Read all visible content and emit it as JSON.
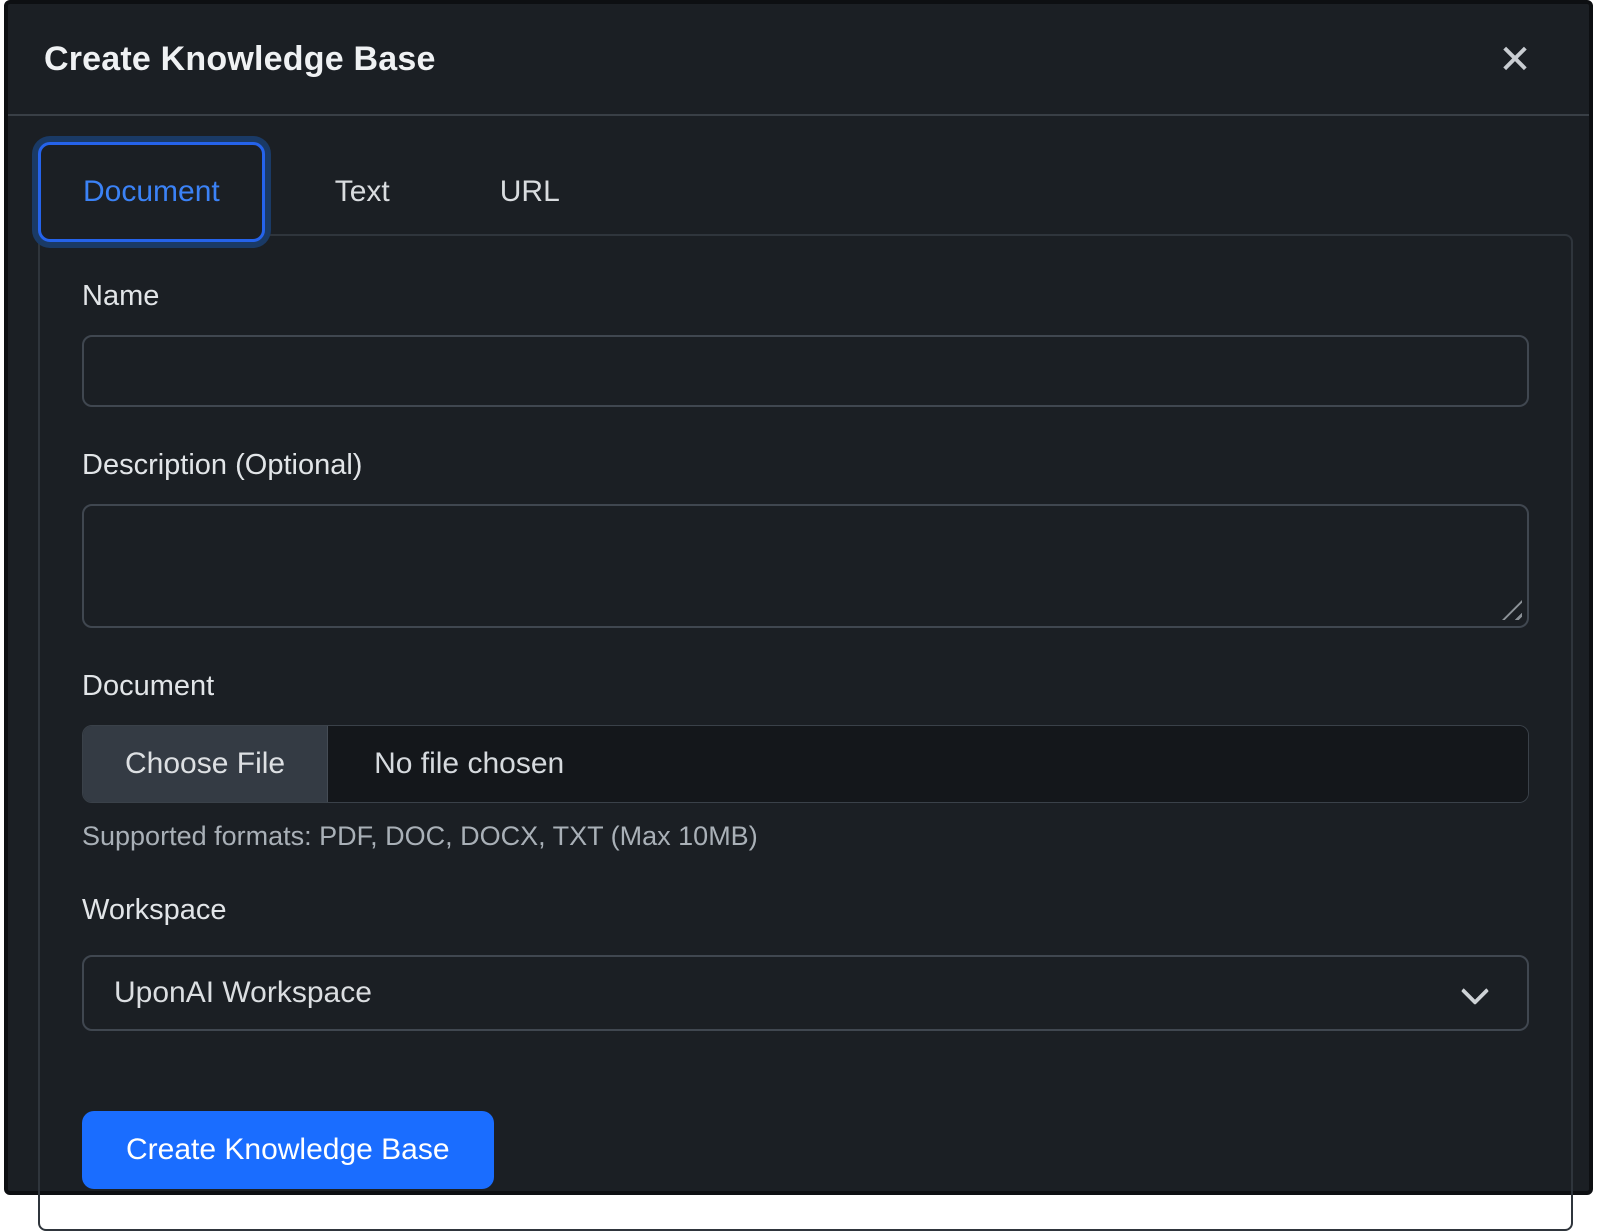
{
  "window": {
    "title": "Create Knowledge Base"
  },
  "icons": {
    "close": "✕",
    "chevron_down": "chevron-down",
    "resize_handle": "resize-grip"
  },
  "tabs": [
    {
      "label": "Document",
      "active": true
    },
    {
      "label": "Text",
      "active": false
    },
    {
      "label": "URL",
      "active": false
    }
  ],
  "form": {
    "name": {
      "label": "Name",
      "value": "",
      "placeholder": ""
    },
    "description": {
      "label": "Description (Optional)",
      "value": "",
      "placeholder": ""
    },
    "document": {
      "label": "Document",
      "choose_file": "Choose File",
      "no_file": "No file chosen",
      "hint": "Supported formats: PDF, DOC, DOCX, TXT (Max 10MB)"
    },
    "workspace": {
      "label": "Workspace",
      "selected": "UponAI Workspace"
    },
    "submit": "Create Knowledge Base"
  },
  "colors": {
    "modal_bg": "#1b1f24",
    "accent_blue": "#1a6dff",
    "tab_active_text": "#3b82f6",
    "tab_active_border": "#2563eb",
    "tab_focus_ring": "#1a3a66",
    "border_subtle": "#404750",
    "file_button_bg": "#343b44",
    "hint_text": "#a9b0b7"
  }
}
